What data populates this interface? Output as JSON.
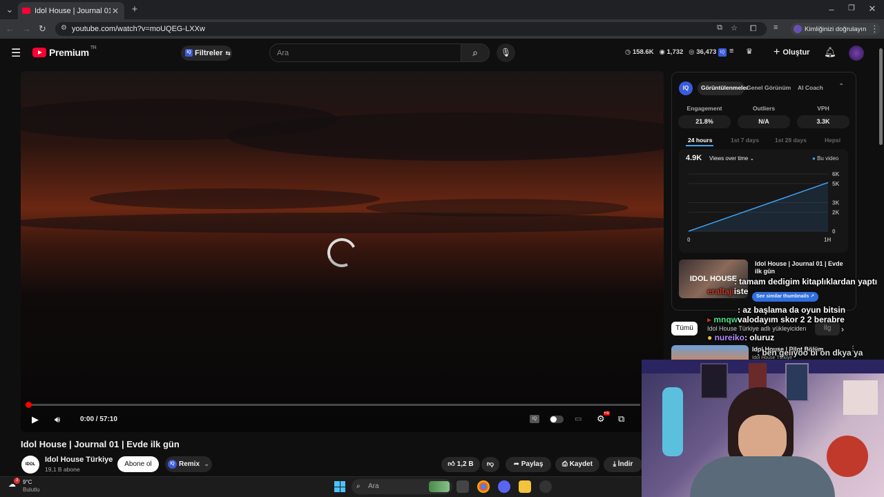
{
  "browser": {
    "tab_title": "Idol House | Journal 01 | Evde i",
    "url": "youtube.com/watch?v=moUQEG-LXXw",
    "profile_label": "Kimliğinizi doğrulayın"
  },
  "header": {
    "logo_text": "Premium",
    "region": "TR",
    "filters_label": "Filtreler",
    "search_placeholder": "Ara",
    "stats": [
      "158.6K",
      "1,732",
      "36,473"
    ],
    "create_label": "Oluştur"
  },
  "player": {
    "time": "0:00 / 57:10",
    "progress_fraction": 0.0,
    "settings_badge": "HD"
  },
  "video": {
    "title": "Idol House | Journal 01 | Evde ilk gün",
    "channel": "Idol House Türkiye",
    "subscribers": "19,1 B abone",
    "subscribe_label": "Abone ol",
    "remix_label": "Remix",
    "likes": "1,2 B",
    "share_label": "Paylaş",
    "save_label": "Kaydet",
    "download_label": "İndir",
    "channel_avatar_text": "IDOL"
  },
  "panel": {
    "logo": "IQ",
    "tabs": [
      "Görüntülenmeler",
      "Genel Görünüm",
      "AI Coach"
    ],
    "metrics": [
      {
        "label": "Engagement",
        "value": "21.8%"
      },
      {
        "label": "Outliers",
        "value": "N/A"
      },
      {
        "label": "VPH",
        "value": "3.3K"
      }
    ],
    "ranges": [
      "24 hours",
      "1st 7 days",
      "1st 28 days",
      "Hepsi"
    ],
    "views_total": "4.9K",
    "views_dropdown": "Views over time",
    "legend": "Bu video"
  },
  "chart_data": {
    "type": "line",
    "x": [
      0,
      1
    ],
    "xticks": [
      "0",
      "1H"
    ],
    "series": [
      {
        "name": "Bu video",
        "values": [
          0,
          5.1
        ]
      }
    ],
    "yticks": [
      "6K",
      "5K",
      "3K",
      "2K",
      "0"
    ],
    "ylim": [
      0,
      6
    ],
    "color": "#3ea6ff"
  },
  "recommendations": {
    "chips": [
      "Tümü",
      "İlg"
    ],
    "items": [
      {
        "title": "Idol House | Journal 01 | Evde ilk gün",
        "cta": "See similar thumbnails",
        "thumb_text": "IDOL HOUSE"
      },
      {
        "title": "Idol House | Pilot Bölüm",
        "channel": "Idol House Türkiye"
      }
    ],
    "uploader_note": "Idol House Türkiye adlı yükleyiciden"
  },
  "chat_overlay": [
    {
      "user": "eraltaji",
      "text": ": tamam dedigim kitaplıklardan yaptırtxan iste"
    },
    {
      "user": "mnqw",
      "text": ": az başlama da oyun bitsin valodayım skor 2 2 berabre"
    },
    {
      "user": "nureiko",
      "text": ": oluruz"
    },
    {
      "user": "",
      "text": ": ben geliyoo bi on dkya ya"
    }
  ],
  "taskbar": {
    "weather_temp": "9°C",
    "weather_desc": "Bulutlu",
    "weather_badge": "3",
    "search_label": "Ara"
  },
  "colors": {
    "accent_red": "#ff0033",
    "accent_blue": "#3ea6ff",
    "mnqw_color": "#4ee08a",
    "nureiko_color": "#b58cff"
  }
}
